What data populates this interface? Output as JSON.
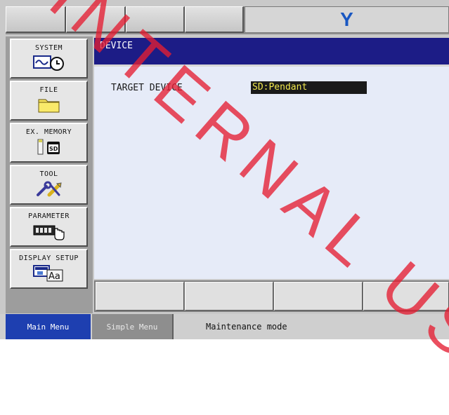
{
  "app": {
    "logo_text": "Y",
    "brand_color": "#1957c2"
  },
  "left_menu": {
    "items": [
      {
        "label": "SYSTEM",
        "icon": "system-monitor-clock-icon"
      },
      {
        "label": "FILE",
        "icon": "folder-icon"
      },
      {
        "label": "EX. MEMORY",
        "icon": "sd-card-icon"
      },
      {
        "label": "TOOL",
        "icon": "tools-wrench-icon"
      },
      {
        "label": "PARAMETER",
        "icon": "parameter-hand-icon"
      },
      {
        "label": "DISPLAY SETUP",
        "icon": "display-font-icon"
      }
    ]
  },
  "screen": {
    "title": "DEVICE",
    "fields": [
      {
        "label": "TARGET DEVICE",
        "value": "SD:Pendant"
      }
    ]
  },
  "status_bar": {
    "main_menu_label": "Main Menu",
    "simple_menu_label": "Simple Menu",
    "mode_text": "Maintenance mode"
  },
  "watermark": {
    "text": "INTERNAL USE"
  },
  "colors": {
    "title_bar": "#1c1c86",
    "value_text": "#f1e84e",
    "main_menu_tab": "#1e3fb0",
    "watermark": "#e41e32"
  }
}
